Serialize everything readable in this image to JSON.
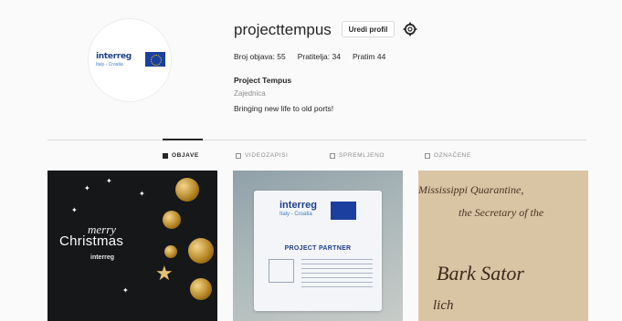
{
  "profile": {
    "username": "projecttempus",
    "edit_button": "Uredi profil",
    "stats": {
      "posts": "Broj objava: 55",
      "followers": "Pratitelja: 34",
      "following": "Pratim 44"
    },
    "display_name": "Project Tempus",
    "category": "Zajednica",
    "bio": "Bringing new life to old ports!",
    "avatar_logo": {
      "word": "interreg",
      "sub": "Italy - Croatia"
    }
  },
  "tabs": [
    {
      "label": "OBJAVE",
      "active": true
    },
    {
      "label": "VIDEOZAPISI",
      "active": false
    },
    {
      "label": "SPREMLJENO",
      "active": false
    },
    {
      "label": "OZNAČENE",
      "active": false
    }
  ],
  "posts": [
    {
      "type": "christmas",
      "merry": "merry",
      "title": "Christmas",
      "logo": "interreg"
    },
    {
      "type": "partner-card",
      "logo_word": "interreg",
      "logo_sub": "Italy - Croatia",
      "heading": "PROJECT PARTNER"
    },
    {
      "type": "manuscript",
      "line1": "Mississippi Quarantine,",
      "line2": "the Secretary of the",
      "line3": "Bark Sator",
      "line4": "lich"
    }
  ],
  "colors": {
    "background": "#fafafa",
    "divider": "#dbdbdb",
    "text": "#262626",
    "muted": "#8e8e8e",
    "interreg_blue": "#1f3f8f",
    "eu_blue": "#1a3f9e"
  },
  "icons": {
    "settings": "gear-icon",
    "grid_tab": "grid-icon",
    "video_tab": "video-icon",
    "saved_tab": "bookmark-icon",
    "tagged_tab": "tag-icon"
  }
}
